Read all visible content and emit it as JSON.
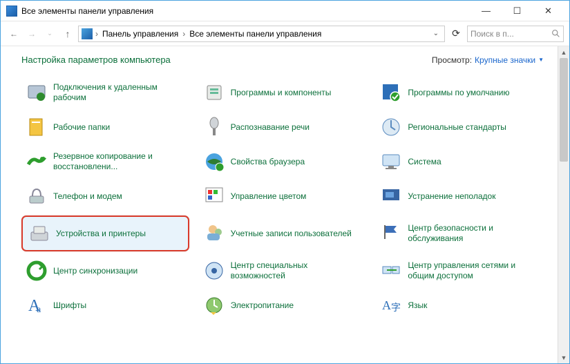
{
  "window": {
    "title": "Все элементы панели управления"
  },
  "titlebar": {
    "min": "—",
    "max": "☐",
    "close": "✕"
  },
  "nav": {
    "crumb1": "Панель управления",
    "crumb2": "Все элементы панели управления",
    "search_placeholder": "Поиск в п..."
  },
  "header": {
    "title": "Настройка параметров компьютера",
    "view_label": "Просмотр:",
    "view_value": "Крупные значки"
  },
  "items": [
    {
      "label": "Подключения к удаленным рабочим"
    },
    {
      "label": "Программы и компоненты"
    },
    {
      "label": "Программы по умолчанию"
    },
    {
      "label": "Рабочие папки"
    },
    {
      "label": "Распознавание речи"
    },
    {
      "label": "Региональные стандарты"
    },
    {
      "label": "Резервное копирование и восстановлени..."
    },
    {
      "label": "Свойства браузера"
    },
    {
      "label": "Система"
    },
    {
      "label": "Телефон и модем"
    },
    {
      "label": "Управление цветом"
    },
    {
      "label": "Устранение неполадок"
    },
    {
      "label": "Устройства и принтеры",
      "highlight": true
    },
    {
      "label": "Учетные записи пользователей"
    },
    {
      "label": "Центр безопасности и обслуживания"
    },
    {
      "label": "Центр синхронизации"
    },
    {
      "label": "Центр специальных возможностей"
    },
    {
      "label": "Центр управления сетями и общим доступом"
    },
    {
      "label": "Шрифты"
    },
    {
      "label": "Электропитание"
    },
    {
      "label": "Язык"
    }
  ]
}
